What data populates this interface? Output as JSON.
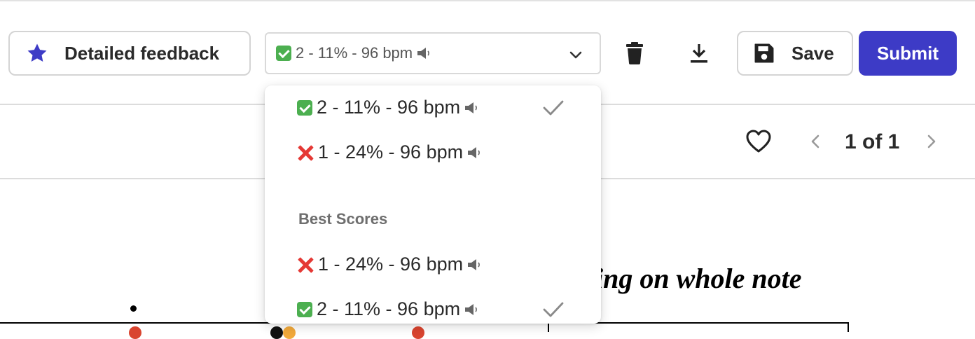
{
  "toolbar": {
    "feedback_label": "Detailed feedback",
    "attempt_select": {
      "status": "correct",
      "value": "2 - 11% - 96 bpm"
    },
    "save_label": "Save",
    "submit_label": "Submit"
  },
  "pager": {
    "text": "1 of 1"
  },
  "score": {
    "title_fragment": "ding on whole note"
  },
  "dropdown": {
    "options": [
      {
        "status": "correct",
        "label": "2 - 11% - 96 bpm",
        "selected": true
      },
      {
        "status": "incorrect",
        "label": "1 - 24% - 96 bpm",
        "selected": false
      }
    ],
    "group_label": "Best Scores",
    "best_scores": [
      {
        "status": "incorrect",
        "label": "1 - 24% - 96 bpm",
        "selected": false
      },
      {
        "status": "correct",
        "label": "2 - 11% - 96 bpm",
        "selected": true
      }
    ]
  },
  "colors": {
    "accent": "#3d3bc6",
    "star": "#3d3bc6",
    "correct": "#4caf50",
    "incorrect": "#e53935"
  },
  "icons": {
    "feedback": "star-icon",
    "select_caret": "chevron-down-icon",
    "delete": "trash-icon",
    "download": "download-icon",
    "save": "floppy-disk-icon",
    "favorite": "heart-icon",
    "prev": "chevron-left-icon",
    "next": "chevron-right-icon",
    "audio": "speaker-icon",
    "selected": "checkmark-icon"
  }
}
